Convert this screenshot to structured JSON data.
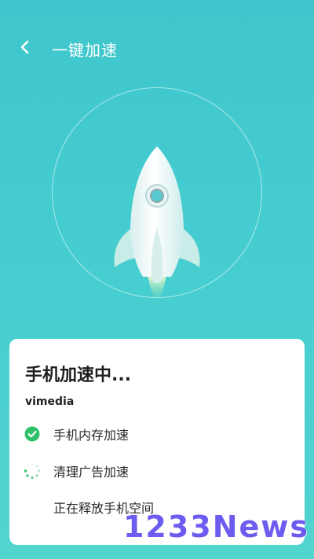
{
  "header": {
    "back_icon": "chevron-left-icon",
    "title": "一键加速"
  },
  "status_card": {
    "title": "手机加速中...",
    "subtitle": "vimedia",
    "tasks": [
      {
        "label": "手机内存加速",
        "state": "done",
        "icon": "check-circle-icon",
        "color": "#2fc06a"
      },
      {
        "label": "清理广告加速",
        "state": "in-progress",
        "icon": "spinner-icon",
        "color": "#2fc06a"
      },
      {
        "label": "正在释放手机空间",
        "state": "pending"
      }
    ]
  },
  "watermark": {
    "text": "1233News"
  },
  "colors": {
    "background_top": "#3fc6cc",
    "background_bottom": "#52d4cf",
    "accent_green": "#2fc06a",
    "watermark": "#6d5cf0"
  }
}
